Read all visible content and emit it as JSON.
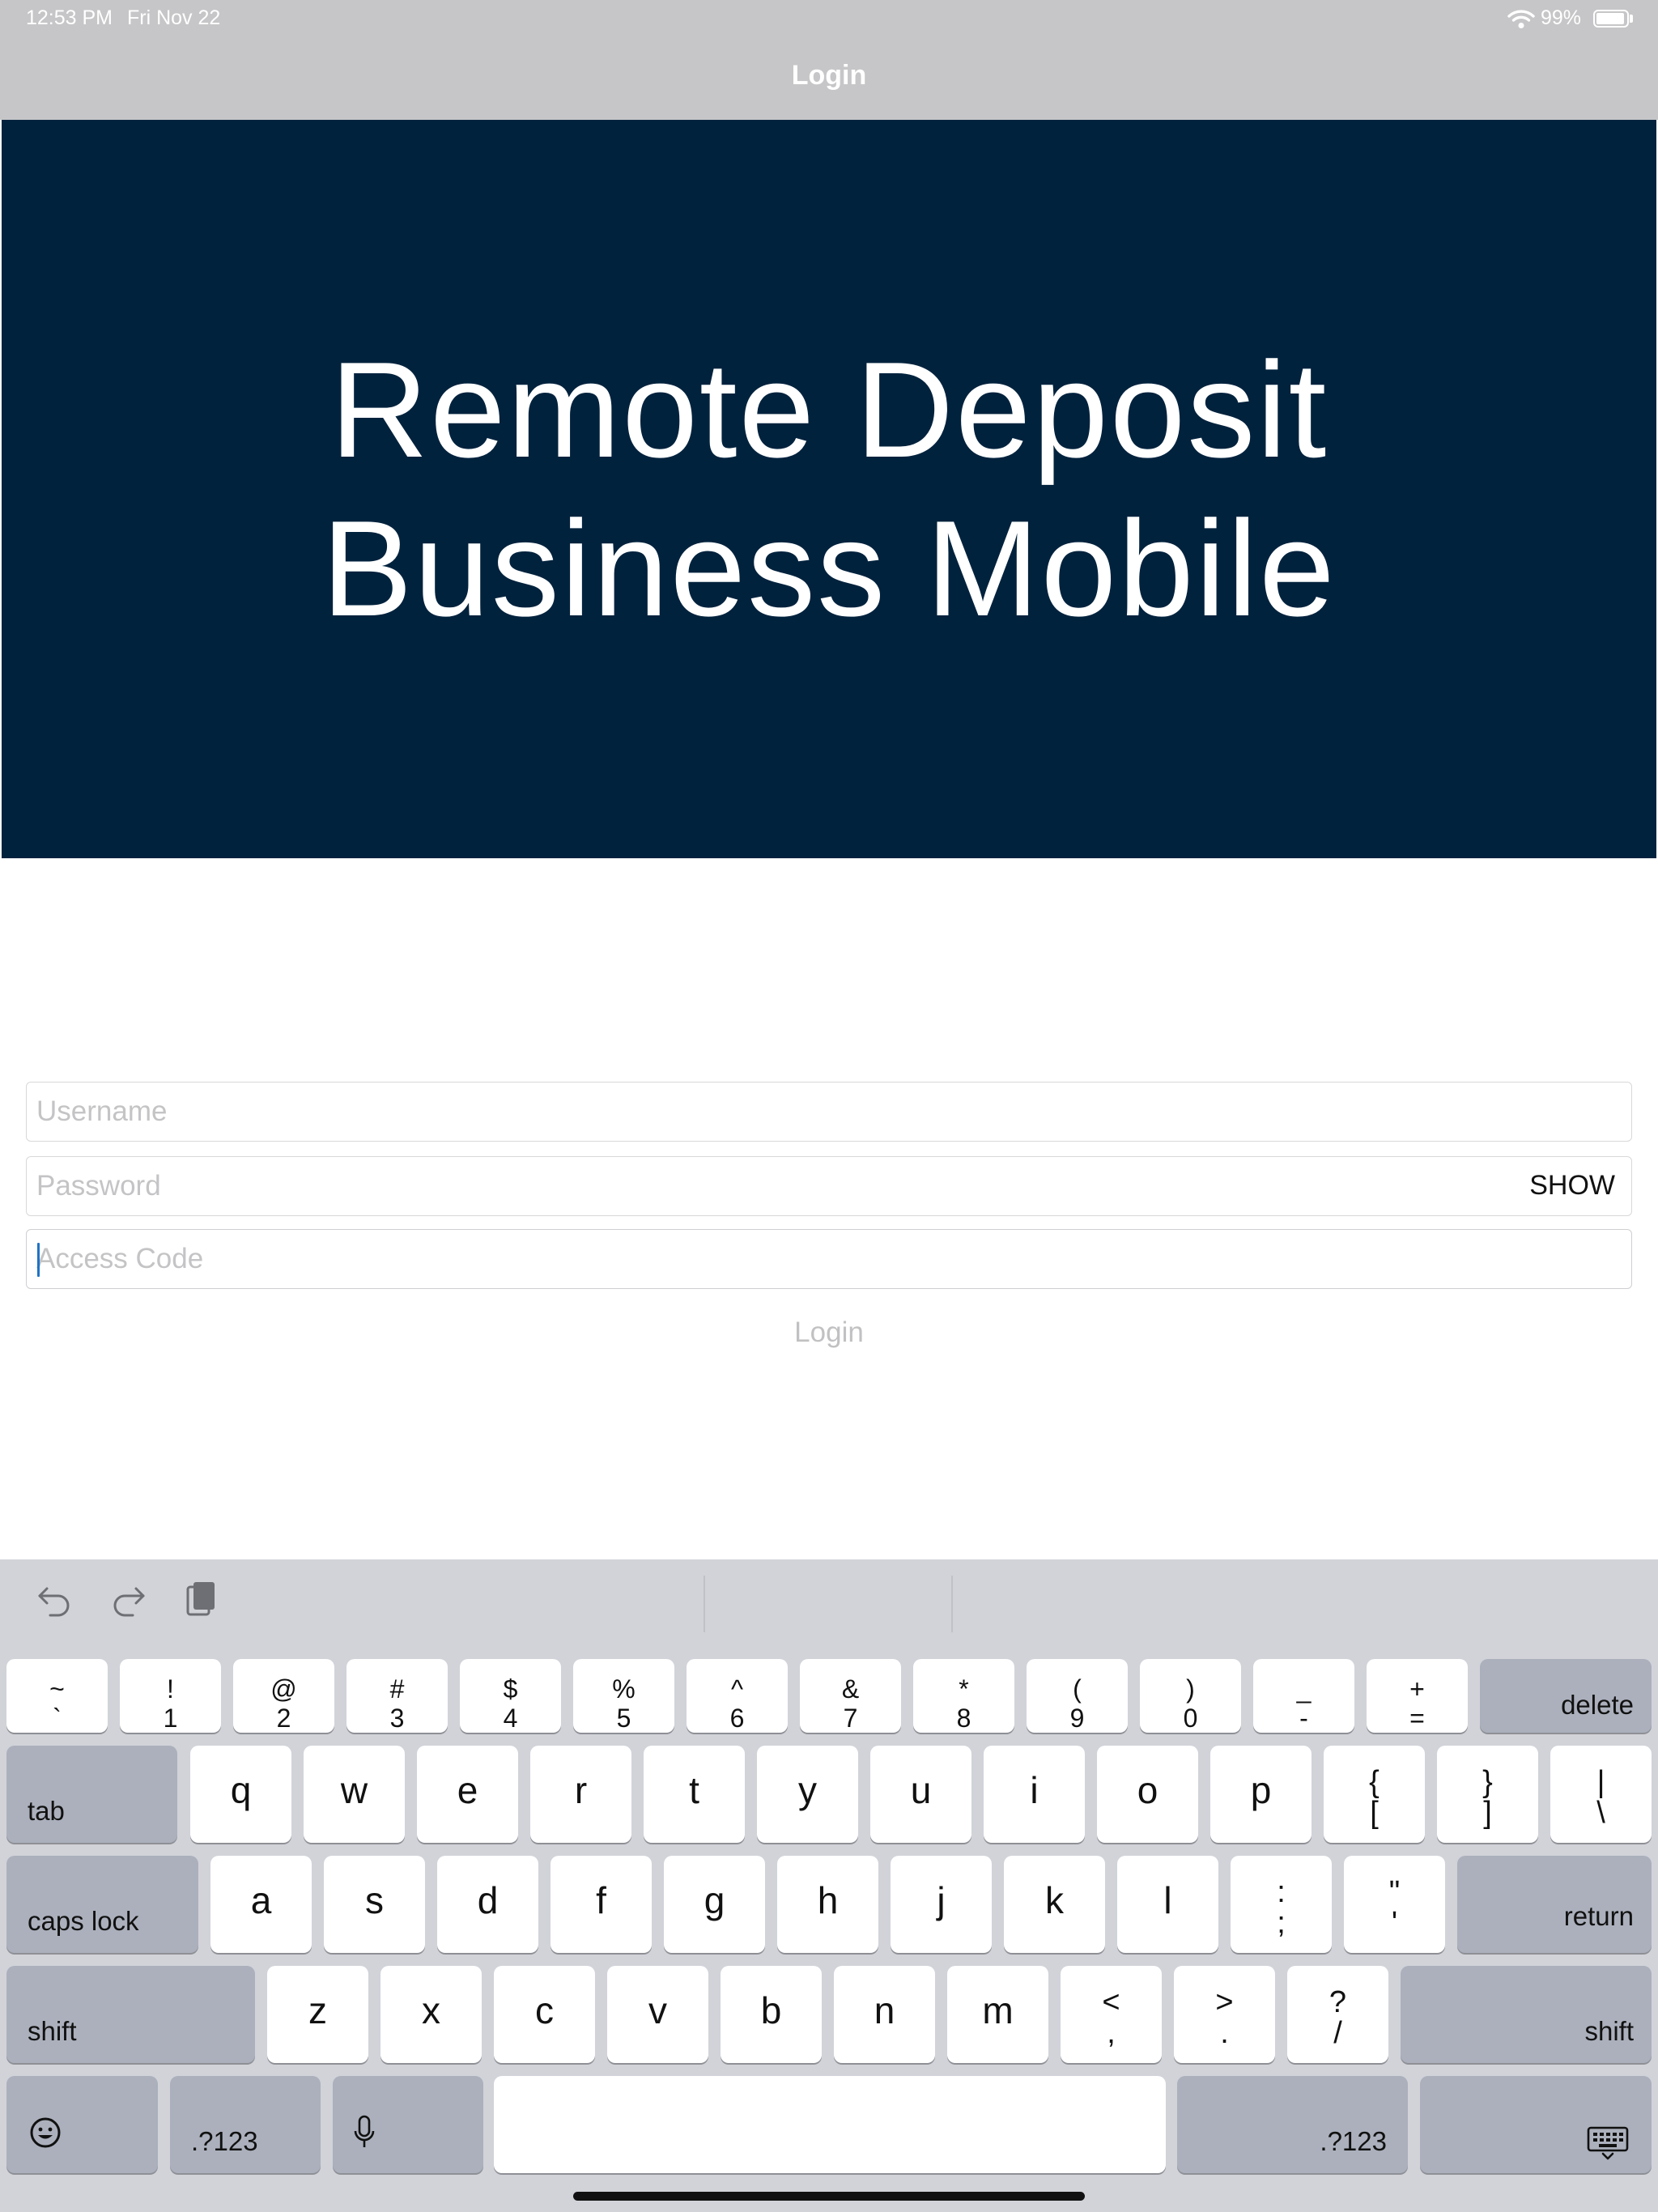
{
  "status_bar": {
    "time": "12:53 PM",
    "date": "Fri Nov 22",
    "battery": "99%",
    "wifi_icon": "wifi-icon",
    "battery_icon": "battery-icon"
  },
  "nav": {
    "title": "Login"
  },
  "banner": {
    "line1": "Remote Deposit",
    "line2": "Business Mobile",
    "background": "#01223d"
  },
  "form": {
    "username_placeholder": "Username",
    "password_placeholder": "Password",
    "show_label": "SHOW",
    "access_code_placeholder": "Access Code",
    "login_label": "Login"
  },
  "keyboard": {
    "toolbar_icons": [
      "undo-icon",
      "redo-icon",
      "paste-icon"
    ],
    "number_row": [
      {
        "top": "~",
        "bottom": "`"
      },
      {
        "top": "!",
        "bottom": "1"
      },
      {
        "top": "@",
        "bottom": "2"
      },
      {
        "top": "#",
        "bottom": "3"
      },
      {
        "top": "$",
        "bottom": "4"
      },
      {
        "top": "%",
        "bottom": "5"
      },
      {
        "top": "^",
        "bottom": "6"
      },
      {
        "top": "&",
        "bottom": "7"
      },
      {
        "top": "*",
        "bottom": "8"
      },
      {
        "top": "(",
        "bottom": "9"
      },
      {
        "top": ")",
        "bottom": "0"
      },
      {
        "top": "_",
        "bottom": "-"
      },
      {
        "top": "+",
        "bottom": "="
      }
    ],
    "row2": [
      "q",
      "w",
      "e",
      "r",
      "t",
      "y",
      "u",
      "i",
      "o",
      "p"
    ],
    "row2_symbols": [
      {
        "top": "{",
        "bottom": "["
      },
      {
        "top": "}",
        "bottom": "]"
      },
      {
        "top": "|",
        "bottom": "\\"
      }
    ],
    "row3": [
      "a",
      "s",
      "d",
      "f",
      "g",
      "h",
      "j",
      "k",
      "l"
    ],
    "row3_symbols": [
      {
        "top": ":",
        "bottom": ";"
      },
      {
        "top": "\"",
        "bottom": "'"
      }
    ],
    "row4": [
      "z",
      "x",
      "c",
      "v",
      "b",
      "n",
      "m"
    ],
    "row4_symbols": [
      {
        "top": "<",
        "bottom": ","
      },
      {
        "top": ">",
        "bottom": "."
      },
      {
        "top": "?",
        "bottom": "/"
      }
    ],
    "labels": {
      "delete": "delete",
      "tab": "tab",
      "caps_lock": "caps lock",
      "return": "return",
      "shift": "shift",
      "numbers": ".?123"
    },
    "special_icons": [
      "emoji-icon",
      "microphone-icon",
      "keyboard-dismiss-icon"
    ]
  }
}
